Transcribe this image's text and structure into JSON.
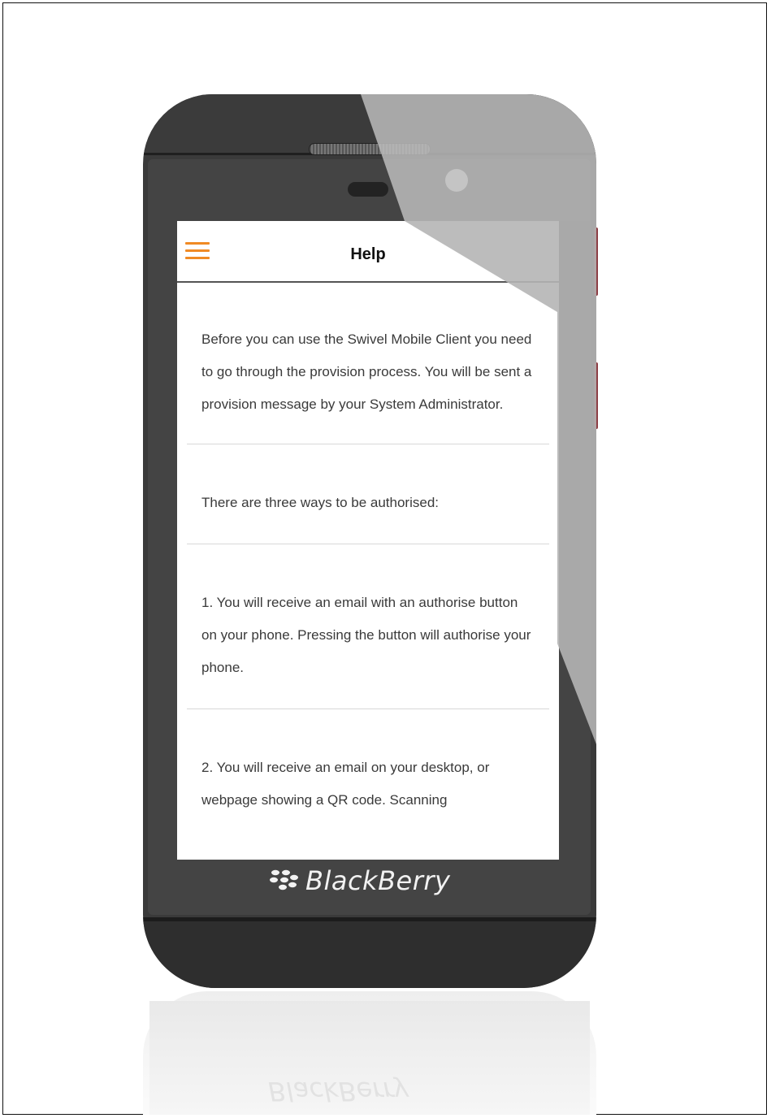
{
  "device": {
    "brand_name": "BlackBerry",
    "reflection_brand_name": "BlackBerry"
  },
  "header": {
    "title": "Help",
    "menu_icon": "hamburger-menu-icon",
    "accent_color": "#f08a24"
  },
  "content": {
    "sections": [
      "Before you can use the Swivel Mobile Client you need to go through the provision process. You will be sent a provision message by your System Administrator.",
      "There are three ways to be authorised:",
      "1. You will receive an email with an authorise button on your phone. Pressing the button will authorise your phone.",
      "2. You will receive an email on your desktop, or webpage showing a QR code. Scanning"
    ]
  }
}
